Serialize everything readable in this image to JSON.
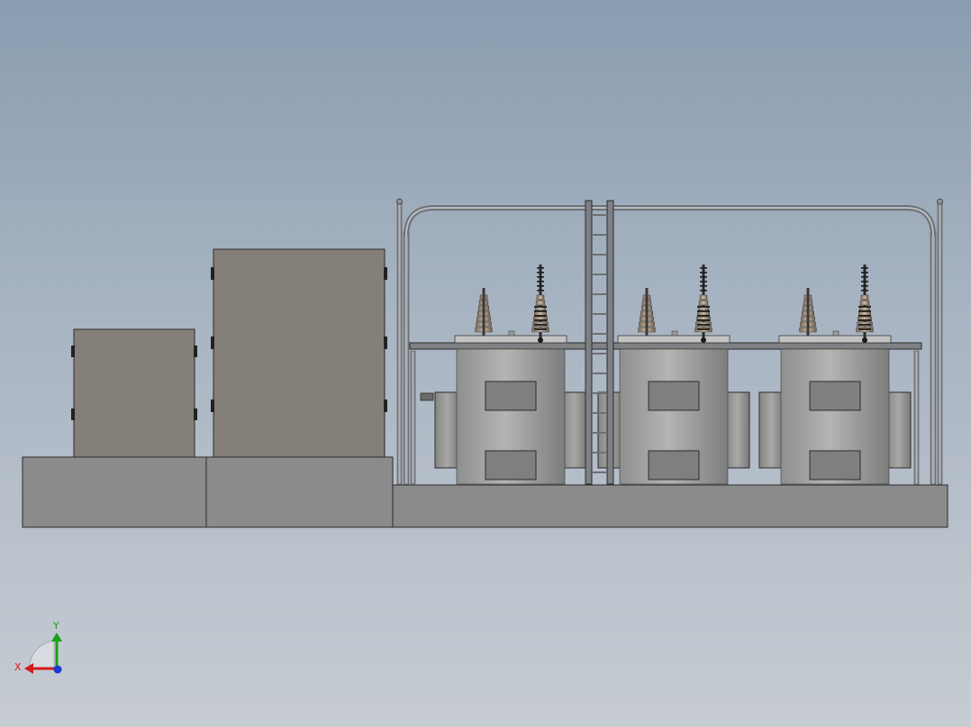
{
  "viewport": {
    "background_top": "#8a9cb0",
    "background_bottom": "#c7ccd3"
  },
  "model": {
    "cabinet_color": "#857f79",
    "base_color": "#8c8c8c",
    "transformer_body_color": "#9a9a98",
    "bushing_color": "#a89582",
    "pipe_color": "#8f9296",
    "transformer_count": 3
  },
  "triad": {
    "x_label": "X",
    "y_label": "Y",
    "x_color": "#d11a1a",
    "y_color": "#18a018",
    "z_color": "#1a3ad1"
  }
}
